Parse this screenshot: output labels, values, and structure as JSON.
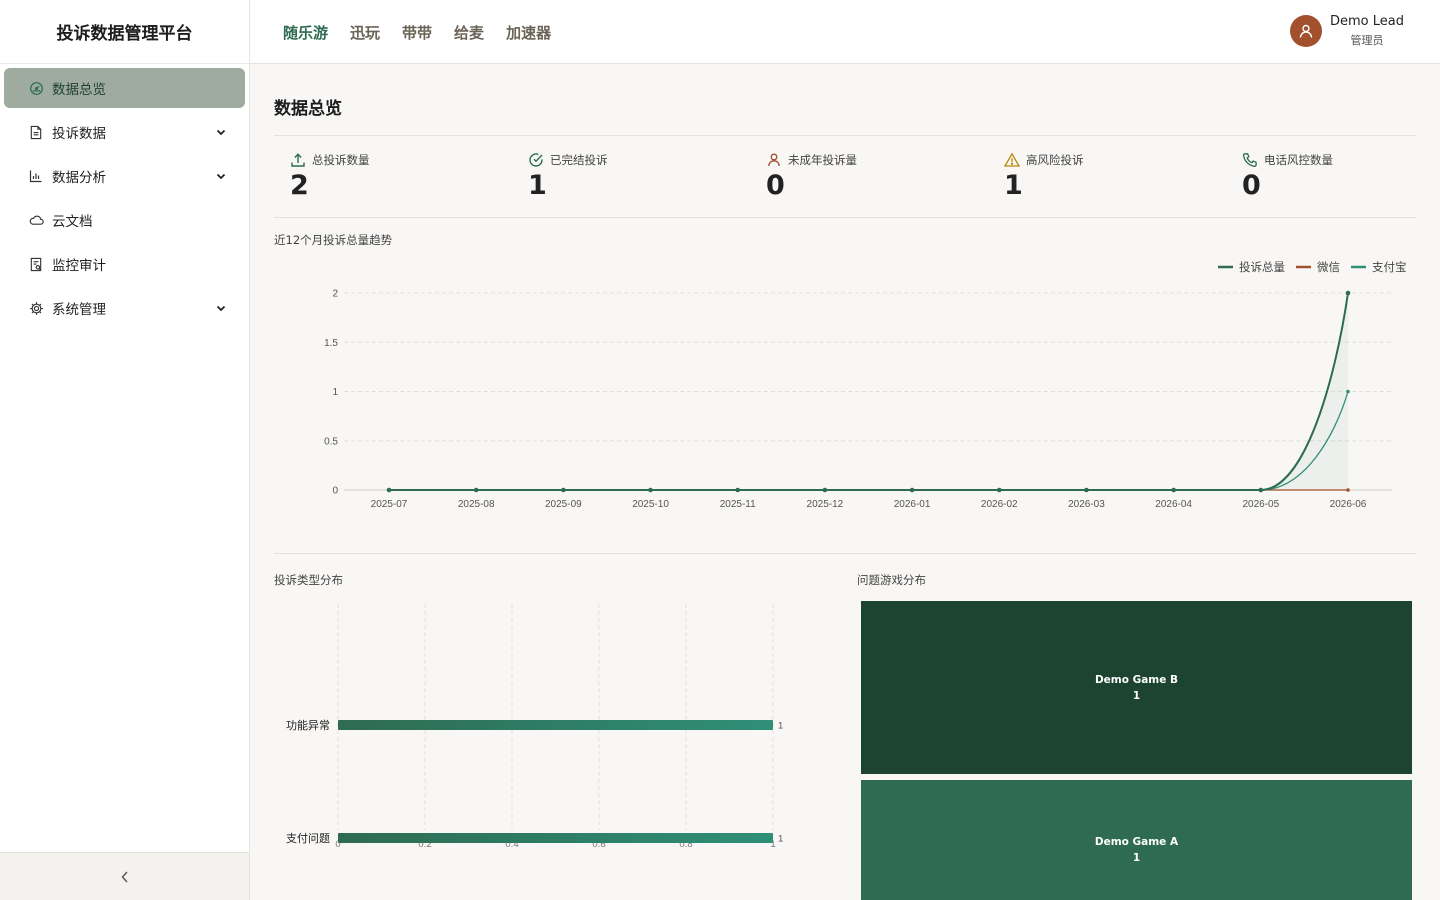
{
  "app": {
    "title": "投诉数据管理平台"
  },
  "sidebar": {
    "items": [
      {
        "label": "数据总览",
        "icon": "dashboard-icon",
        "active": true,
        "expandable": false
      },
      {
        "label": "投诉数据",
        "icon": "document-icon",
        "active": false,
        "expandable": true
      },
      {
        "label": "数据分析",
        "icon": "bar-chart-icon",
        "active": false,
        "expandable": true
      },
      {
        "label": "云文档",
        "icon": "cloud-icon",
        "active": false,
        "expandable": false
      },
      {
        "label": "监控审计",
        "icon": "audit-icon",
        "active": false,
        "expandable": false
      },
      {
        "label": "系统管理",
        "icon": "gear-icon",
        "active": false,
        "expandable": true
      }
    ],
    "collapse_icon": "chevron-left-icon"
  },
  "header": {
    "tabs": [
      {
        "label": "随乐游",
        "active": true
      },
      {
        "label": "迅玩",
        "active": false
      },
      {
        "label": "带带",
        "active": false
      },
      {
        "label": "给麦",
        "active": false
      },
      {
        "label": "加速器",
        "active": false
      }
    ],
    "user": {
      "name": "Demo Lead",
      "role": "管理员",
      "avatar_color": "#a2502e"
    }
  },
  "page": {
    "title": "数据总览"
  },
  "stats": [
    {
      "label": "总投诉数量",
      "value": "2",
      "icon": "upload-icon",
      "color": "#2e6b52"
    },
    {
      "label": "已完结投诉",
      "value": "1",
      "icon": "check-circle-icon",
      "color": "#2e6b52"
    },
    {
      "label": "未成年投诉量",
      "value": "0",
      "icon": "user-icon",
      "color": "#a2502e"
    },
    {
      "label": "高风险投诉",
      "value": "1",
      "icon": "warning-icon",
      "color": "#b8860b"
    },
    {
      "label": "电话风控数量",
      "value": "0",
      "icon": "phone-icon",
      "color": "#2e6b52"
    }
  ],
  "chart_titles": {
    "trend": "近12个月投诉总量趋势",
    "types": "投诉类型分布",
    "games": "问题游戏分布"
  },
  "chart_data": [
    {
      "type": "line",
      "title": "近12个月投诉总量趋势",
      "x": [
        "2025-07",
        "2025-08",
        "2025-09",
        "2025-10",
        "2025-11",
        "2025-12",
        "2026-01",
        "2026-02",
        "2026-03",
        "2026-04",
        "2026-05",
        "2026-06"
      ],
      "series": [
        {
          "name": "投诉总量",
          "values": [
            0,
            0,
            0,
            0,
            0,
            0,
            0,
            0,
            0,
            0,
            0,
            2
          ],
          "color": "#2e6b52"
        },
        {
          "name": "微信",
          "values": [
            0,
            0,
            0,
            0,
            0,
            0,
            0,
            0,
            0,
            0,
            0,
            0
          ],
          "color": "#a2502e"
        },
        {
          "name": "支付宝",
          "values": [
            0,
            0,
            0,
            0,
            0,
            0,
            0,
            0,
            0,
            0,
            0,
            1
          ],
          "color": "#2f8f78"
        }
      ],
      "y_ticks": [
        "0",
        "0.5",
        "1",
        "1.5",
        "2"
      ],
      "ylim": [
        0,
        2
      ],
      "grid": true,
      "legend": "top-right",
      "smooth": true
    },
    {
      "type": "bar",
      "orientation": "horizontal",
      "title": "投诉类型分布",
      "categories": [
        "功能异常",
        "支付问题"
      ],
      "values": [
        1,
        1
      ],
      "x_ticks": [
        "0",
        "0.2",
        "0.4",
        "0.6",
        "0.8",
        "1"
      ],
      "xlim": [
        0,
        1
      ],
      "grid": true,
      "colors": [
        "#2e6b52",
        "#2f8f78"
      ]
    },
    {
      "type": "treemap",
      "title": "问题游戏分布",
      "categories": [
        "Demo Game B",
        "Demo Game A"
      ],
      "values": [
        1,
        1
      ],
      "colors": [
        "#1c4431",
        "#2e6b52"
      ]
    }
  ]
}
